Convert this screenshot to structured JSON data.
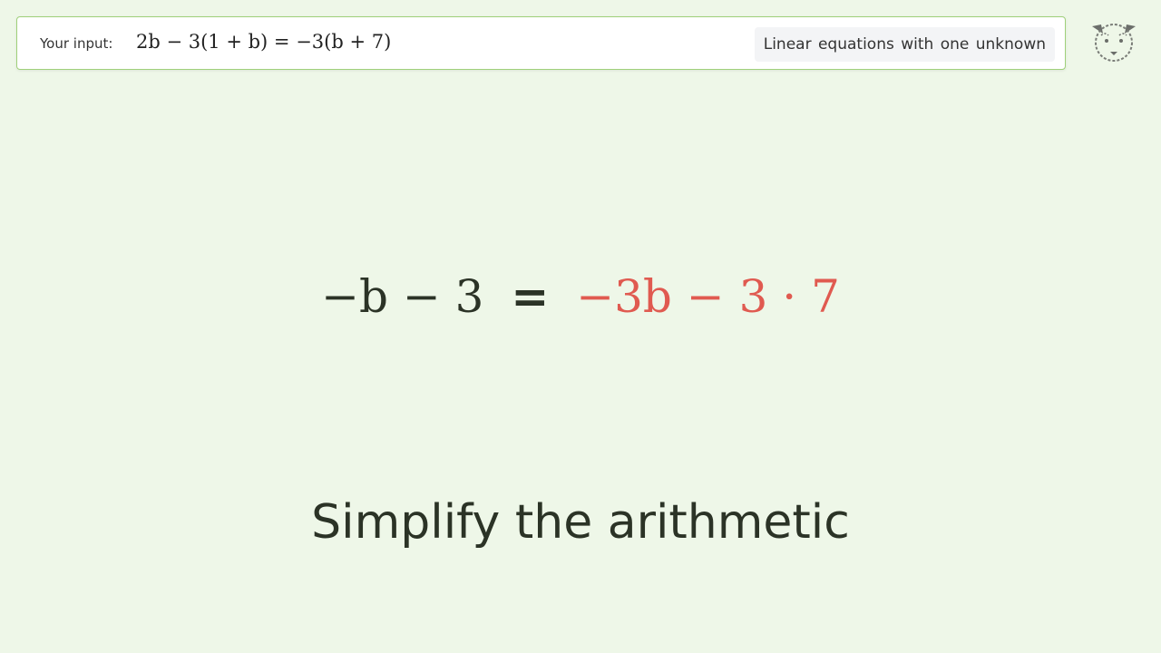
{
  "header": {
    "input_label": "Your input:",
    "input_expression": "2b − 3(1 + b) = −3(b + 7)",
    "category": "Linear equations with one unknown",
    "logo_icon": "leopard-head-icon"
  },
  "main": {
    "equation": {
      "lhs": "−b − 3",
      "equals": "=",
      "rhs": "−3b − 3 · 7",
      "rhs_color": "#e05a50"
    },
    "step_title": "Simplify the arithmetic"
  }
}
